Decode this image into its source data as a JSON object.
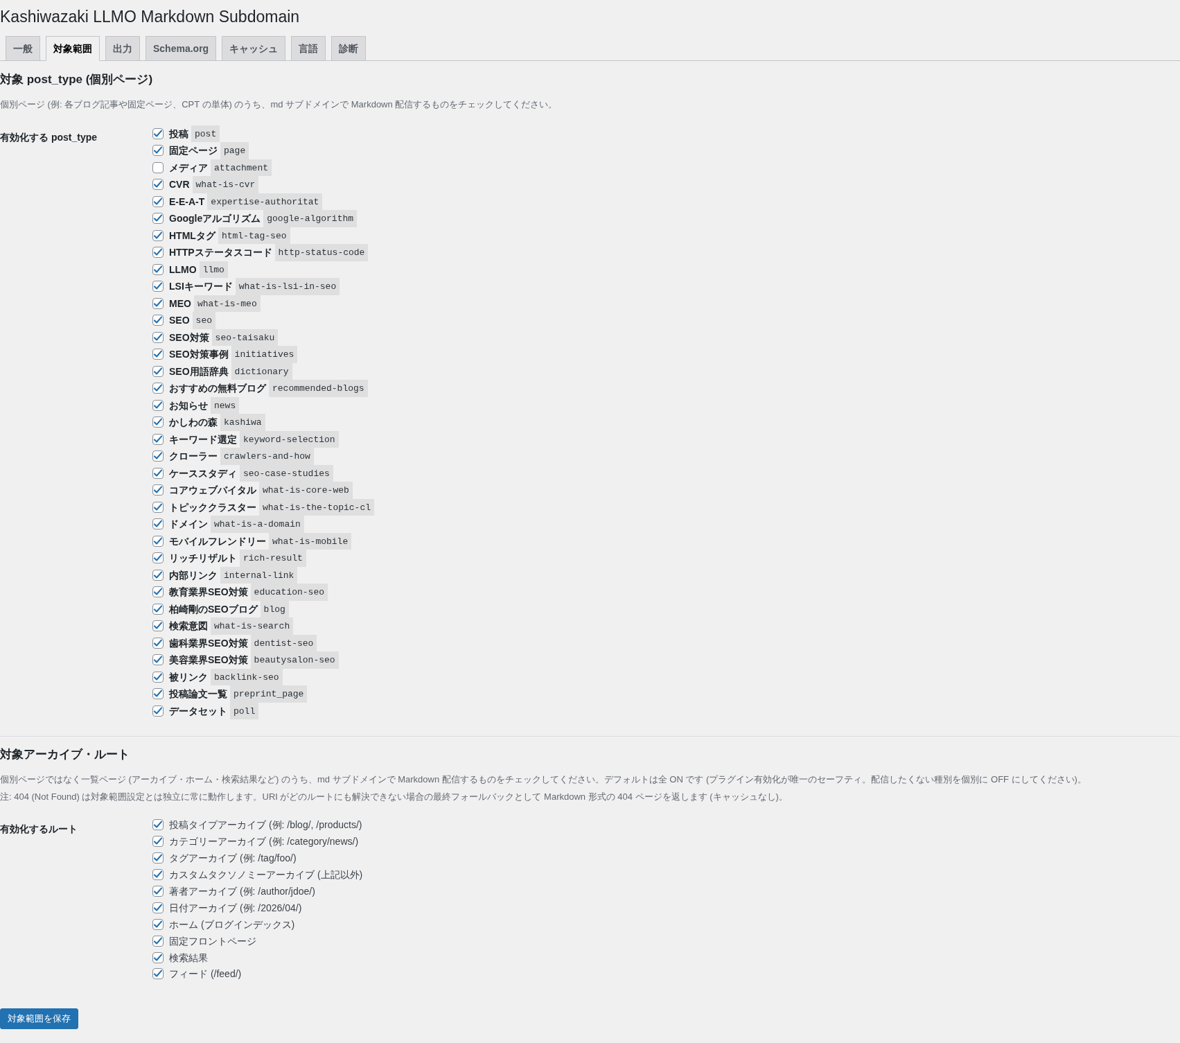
{
  "title": "Kashiwazaki LLMO Markdown Subdomain",
  "tabs": [
    {
      "label": "一般",
      "selected": false
    },
    {
      "label": "対象範囲",
      "selected": true
    },
    {
      "label": "出力",
      "selected": false
    },
    {
      "label": "Schema.org",
      "selected": false
    },
    {
      "label": "キャッシュ",
      "selected": false
    },
    {
      "label": "言語",
      "selected": false
    },
    {
      "label": "診断",
      "selected": false
    }
  ],
  "post_type_section": {
    "heading": "対象 post_type (個別ページ)",
    "description": "個別ページ (例: 各ブログ記事や固定ページ、CPT の単体) のうち、md サブドメインで Markdown 配信するものをチェックしてください。",
    "field_label": "有効化する post_type",
    "options": [
      {
        "label": "投稿",
        "slug": "post",
        "checked": true
      },
      {
        "label": "固定ページ",
        "slug": "page",
        "checked": true
      },
      {
        "label": "メディア",
        "slug": "attachment",
        "checked": false
      },
      {
        "label": "CVR",
        "slug": "what-is-cvr",
        "checked": true
      },
      {
        "label": "E-E-A-T",
        "slug": "expertise-authoritat",
        "checked": true
      },
      {
        "label": "Googleアルゴリズム",
        "slug": "google-algorithm",
        "checked": true
      },
      {
        "label": "HTMLタグ",
        "slug": "html-tag-seo",
        "checked": true
      },
      {
        "label": "HTTPステータスコード",
        "slug": "http-status-code",
        "checked": true
      },
      {
        "label": "LLMO",
        "slug": "llmo",
        "checked": true
      },
      {
        "label": "LSIキーワード",
        "slug": "what-is-lsi-in-seo",
        "checked": true
      },
      {
        "label": "MEO",
        "slug": "what-is-meo",
        "checked": true
      },
      {
        "label": "SEO",
        "slug": "seo",
        "checked": true
      },
      {
        "label": "SEO対策",
        "slug": "seo-taisaku",
        "checked": true
      },
      {
        "label": "SEO対策事例",
        "slug": "initiatives",
        "checked": true
      },
      {
        "label": "SEO用語辞典",
        "slug": "dictionary",
        "checked": true
      },
      {
        "label": "おすすめの無料ブログ",
        "slug": "recommended-blogs",
        "checked": true
      },
      {
        "label": "お知らせ",
        "slug": "news",
        "checked": true
      },
      {
        "label": "かしわの森",
        "slug": "kashiwa",
        "checked": true
      },
      {
        "label": "キーワード選定",
        "slug": "keyword-selection",
        "checked": true
      },
      {
        "label": "クローラー",
        "slug": "crawlers-and-how",
        "checked": true
      },
      {
        "label": "ケーススタディ",
        "slug": "seo-case-studies",
        "checked": true
      },
      {
        "label": "コアウェブバイタル",
        "slug": "what-is-core-web",
        "checked": true
      },
      {
        "label": "トピッククラスター",
        "slug": "what-is-the-topic-cl",
        "checked": true
      },
      {
        "label": "ドメイン",
        "slug": "what-is-a-domain",
        "checked": true
      },
      {
        "label": "モバイルフレンドリー",
        "slug": "what-is-mobile",
        "checked": true
      },
      {
        "label": "リッチリザルト",
        "slug": "rich-result",
        "checked": true
      },
      {
        "label": "内部リンク",
        "slug": "internal-link",
        "checked": true
      },
      {
        "label": "教育業界SEO対策",
        "slug": "education-seo",
        "checked": true
      },
      {
        "label": "柏崎剛のSEOブログ",
        "slug": "blog",
        "checked": true
      },
      {
        "label": "検索意図",
        "slug": "what-is-search",
        "checked": true
      },
      {
        "label": "歯科業界SEO対策",
        "slug": "dentist-seo",
        "checked": true
      },
      {
        "label": "美容業界SEO対策",
        "slug": "beautysalon-seo",
        "checked": true
      },
      {
        "label": "被リンク",
        "slug": "backlink-seo",
        "checked": true
      },
      {
        "label": "投稿論文一覧",
        "slug": "preprint_page",
        "checked": true
      },
      {
        "label": "データセット",
        "slug": "poll",
        "checked": true
      }
    ]
  },
  "archive_section": {
    "heading": "対象アーカイブ・ルート",
    "description": "個別ページではなく一覧ページ (アーカイブ・ホーム・検索結果など) のうち、md サブドメインで Markdown 配信するものをチェックしてください。デフォルトは全 ON です (プラグイン有効化が唯一のセーフティ。配信したくない種別を個別に OFF にしてください)。",
    "note": "注: 404 (Not Found) は対象範囲設定とは独立に常に動作します。URI がどのルートにも解決できない場合の最終フォールバックとして Markdown 形式の 404 ページを返します (キャッシュなし)。",
    "field_label": "有効化するルート",
    "options": [
      {
        "label": "投稿タイプアーカイブ (例: /blog/, /products/)",
        "checked": true
      },
      {
        "label": "カテゴリーアーカイブ (例: /category/news/)",
        "checked": true
      },
      {
        "label": "タグアーカイブ (例: /tag/foo/)",
        "checked": true
      },
      {
        "label": "カスタムタクソノミーアーカイブ (上記以外)",
        "checked": true
      },
      {
        "label": "著者アーカイブ (例: /author/jdoe/)",
        "checked": true
      },
      {
        "label": "日付アーカイブ (例: /2026/04/)",
        "checked": true
      },
      {
        "label": "ホーム (ブログインデックス)",
        "checked": true
      },
      {
        "label": "固定フロントページ",
        "checked": true
      },
      {
        "label": "検索結果",
        "checked": true
      },
      {
        "label": "フィード (/feed/)",
        "checked": true
      }
    ]
  },
  "save_button": "対象範囲を保存"
}
